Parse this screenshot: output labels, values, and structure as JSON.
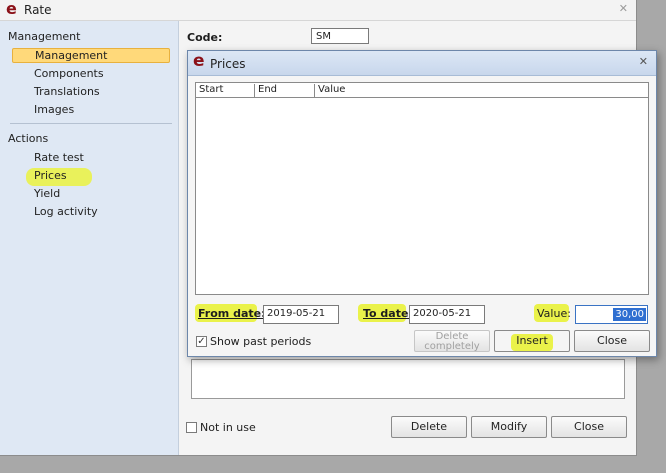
{
  "window": {
    "title": "Rate",
    "close_glyph": "✕"
  },
  "sidebar": {
    "management_header": "Management",
    "management_items": [
      {
        "label": "Management",
        "active": true
      },
      {
        "label": "Components"
      },
      {
        "label": "Translations"
      },
      {
        "label": "Images"
      }
    ],
    "actions_header": "Actions",
    "action_items": [
      {
        "label": "Rate test"
      },
      {
        "label": "Prices"
      },
      {
        "label": "Yield"
      },
      {
        "label": "Log activity"
      }
    ]
  },
  "main": {
    "code_label": "Code:",
    "code_value": "SM",
    "not_in_use_label": "Not in use",
    "delete_label": "Delete",
    "modify_label": "Modify",
    "close_label": "Close"
  },
  "dialog": {
    "title": "Prices",
    "close_glyph": "✕",
    "columns": [
      "Start",
      "End",
      "Value"
    ],
    "from_date_label": "From date:",
    "from_date_value": "2019-05-21",
    "to_date_label": "To date:",
    "to_date_value": "2020-05-21",
    "value_label": "Value:",
    "value_value": "30,00",
    "show_past_label": "Show past periods",
    "show_past_checked": true,
    "delete_completely_label": "Delete completely",
    "insert_label": "Insert",
    "close_label": "Close"
  },
  "colors": {
    "brand": "#8b1118",
    "highlight": "#eaf24a",
    "active_item": "#ffd97a"
  }
}
